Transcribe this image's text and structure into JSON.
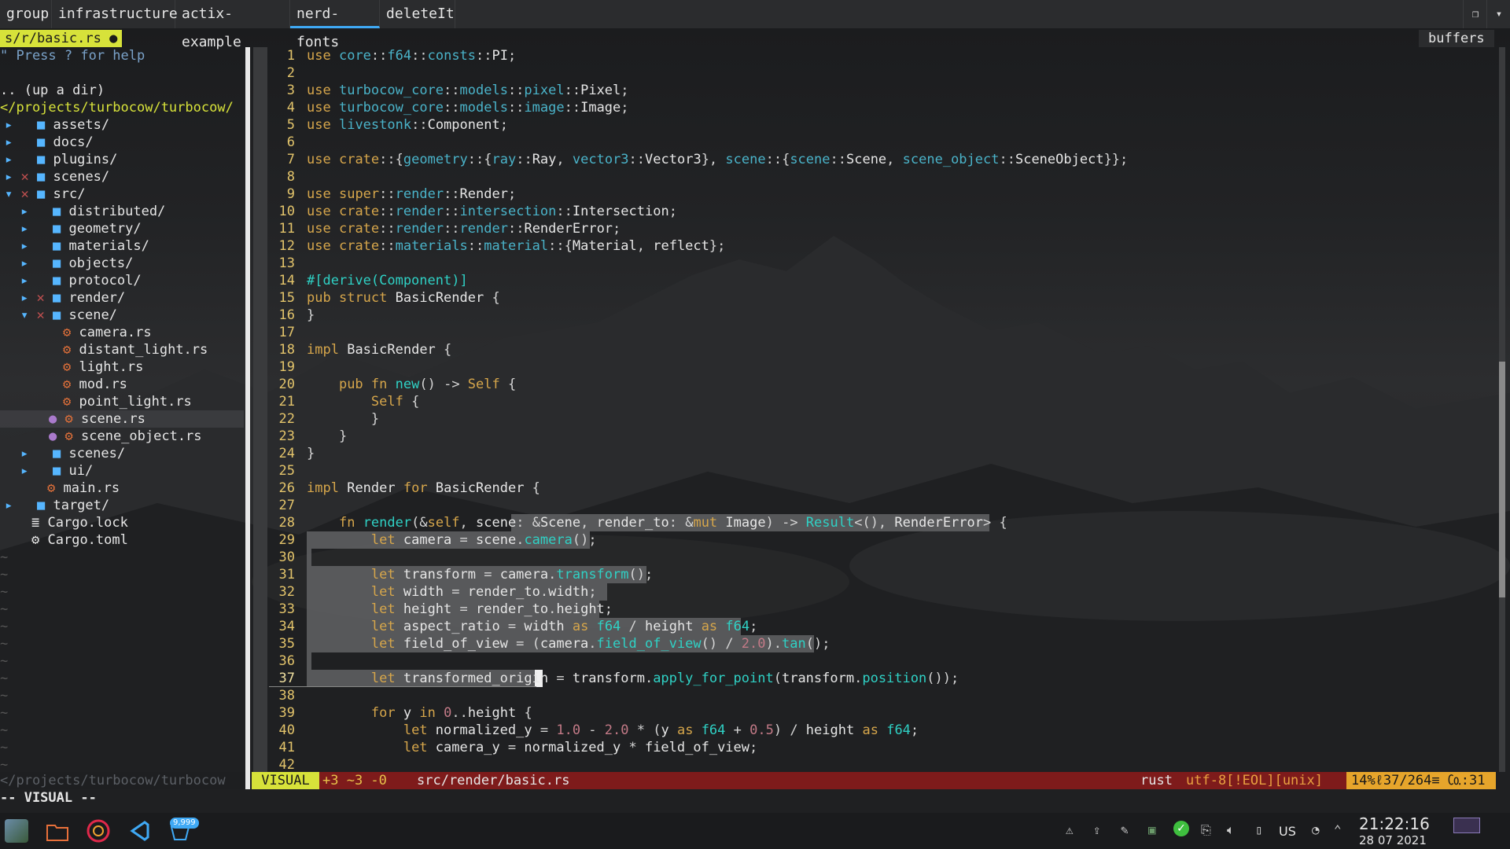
{
  "tabs": [
    "group",
    "infrastructure",
    "actix-example",
    "nerd-fonts",
    "deleteIt"
  ],
  "active_tab": "nerd-fonts",
  "tree_header": "s/r/basic.rs",
  "tree_buffers_label": "buffers",
  "tree": {
    "help": "\" Press ? for help",
    "up": ".. (up a dir)",
    "root": "</projects/turbocow/turbocow/",
    "items": [
      {
        "label": "assets/"
      },
      {
        "label": "docs/"
      },
      {
        "label": "plugins/"
      },
      {
        "label": "scenes/"
      },
      {
        "label": "src/"
      },
      {
        "label": "distributed/"
      },
      {
        "label": "geometry/"
      },
      {
        "label": "materials/"
      },
      {
        "label": "objects/"
      },
      {
        "label": "protocol/"
      },
      {
        "label": "render/"
      },
      {
        "label": "scene/"
      },
      {
        "label": "camera.rs"
      },
      {
        "label": "distant_light.rs"
      },
      {
        "label": "light.rs"
      },
      {
        "label": "mod.rs"
      },
      {
        "label": "point_light.rs"
      },
      {
        "label": "scene.rs"
      },
      {
        "label": "scene_object.rs"
      },
      {
        "label": "scenes/"
      },
      {
        "label": "ui/"
      },
      {
        "label": "main.rs"
      },
      {
        "label": "target/"
      },
      {
        "label": "Cargo.lock"
      },
      {
        "label": "Cargo.toml"
      }
    ],
    "footer_path": "</projects/turbocow/turbocow"
  },
  "code_lines": [
    "use core::f64::consts::PI;",
    "",
    "use turbocow_core::models::pixel::Pixel;",
    "use turbocow_core::models::image::Image;",
    "use livestonk::Component;",
    "",
    "use crate::{geometry::{ray::Ray, vector3::Vector3}, scene::{scene::Scene, scene_object::SceneObject}};",
    "",
    "use super::render::Render;",
    "use crate::render::intersection::Intersection;",
    "use crate::render::render::RenderError;",
    "use crate::materials::material::{Material, reflect};",
    "",
    "#[derive(Component)]",
    "pub struct BasicRender {",
    "}",
    "",
    "impl BasicRender {",
    "",
    "    pub fn new() -> Self {",
    "        Self {",
    "        }",
    "    }",
    "}",
    "",
    "impl Render for BasicRender {",
    "",
    "    fn render(&self, scene: &Scene, render_to: &mut Image) -> Result<(), RenderError> {",
    "        let camera = scene.camera();",
    "",
    "        let transform = camera.transform();",
    "        let width = render_to.width;",
    "        let height = render_to.height;",
    "        let aspect_ratio = width as f64 / height as f64;",
    "        let field_of_view = (camera.field_of_view() / 2.0).tan();",
    "",
    "        let transformed_origin = transform.apply_for_point(transform.position());",
    "",
    "        for y in 0..height {",
    "            let normalized_y = 1.0 - 2.0 * (y as f64 + 0.5) / height as f64;",
    "            let camera_y = normalized_y * field_of_view;",
    ""
  ],
  "status": {
    "mode": "VISUAL",
    "git": "+3 ~3 -0",
    "file": "src/render/basic.rs",
    "filetype": "rust",
    "encoding": "utf-8[!EOL][unix]",
    "position": "14%ℓ37/264≡ ㏇:31"
  },
  "cmdline": "-- VISUAL --",
  "clock": {
    "time": "21:22:16",
    "date": "28 07 2021"
  },
  "tray": {
    "lang": "US",
    "badge": "9,999"
  }
}
